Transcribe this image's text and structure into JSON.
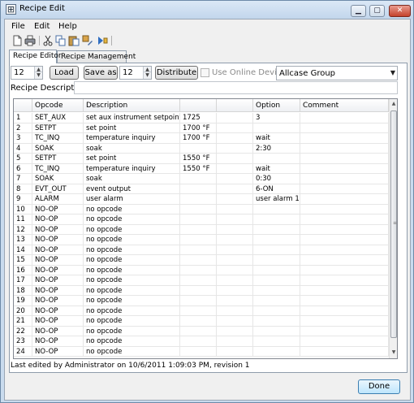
{
  "window": {
    "title": "Recipe Edit",
    "minimize": "▁",
    "maximize": "▢",
    "close": "✕"
  },
  "menu": [
    "File",
    "Edit",
    "Help"
  ],
  "toolbar_icons": [
    "new-file-icon",
    "print-icon",
    "cut-icon",
    "copy-icon",
    "paste-icon",
    "edit-icon",
    "run-icon"
  ],
  "tabs": [
    "Recipe Editor",
    "Recipe Management"
  ],
  "controls": {
    "recipe_number": "12",
    "load_label": "Load",
    "save_as_label": "Save as",
    "save_number": "12",
    "distribute_label": "Distribute",
    "use_online_label": "Use Online Device",
    "group_value": "Allcase Group",
    "description_label": "Recipe Description:",
    "description_value": ""
  },
  "grid": {
    "columns": [
      "",
      "Opcode",
      "Description",
      "",
      "",
      "Option",
      "Comment"
    ],
    "rows": [
      [
        "1",
        "SET_AUX",
        "set aux instrument setpoint",
        "1725",
        "",
        "3",
        ""
      ],
      [
        "2",
        "SETPT",
        "set point",
        "1700 °F",
        "",
        "",
        ""
      ],
      [
        "3",
        "TC_INQ",
        "temperature inquiry",
        "1700 °F",
        "",
        "wait",
        ""
      ],
      [
        "4",
        "SOAK",
        "soak",
        "",
        "",
        "2:30",
        ""
      ],
      [
        "5",
        "SETPT",
        "set point",
        "1550 °F",
        "",
        "",
        ""
      ],
      [
        "6",
        "TC_INQ",
        "temperature inquiry",
        "1550 °F",
        "",
        "wait",
        ""
      ],
      [
        "7",
        "SOAK",
        "soak",
        "",
        "",
        "0:30",
        ""
      ],
      [
        "8",
        "EVT_OUT",
        "event output",
        "",
        "",
        "6-ON",
        ""
      ],
      [
        "9",
        "ALARM",
        "user alarm",
        "",
        "",
        "user alarm 1",
        ""
      ],
      [
        "10",
        "NO-OP",
        "no opcode",
        "",
        "",
        "",
        ""
      ],
      [
        "11",
        "NO-OP",
        "no opcode",
        "",
        "",
        "",
        ""
      ],
      [
        "12",
        "NO-OP",
        "no opcode",
        "",
        "",
        "",
        ""
      ],
      [
        "13",
        "NO-OP",
        "no opcode",
        "",
        "",
        "",
        ""
      ],
      [
        "14",
        "NO-OP",
        "no opcode",
        "",
        "",
        "",
        ""
      ],
      [
        "15",
        "NO-OP",
        "no opcode",
        "",
        "",
        "",
        ""
      ],
      [
        "16",
        "NO-OP",
        "no opcode",
        "",
        "",
        "",
        ""
      ],
      [
        "17",
        "NO-OP",
        "no opcode",
        "",
        "",
        "",
        ""
      ],
      [
        "18",
        "NO-OP",
        "no opcode",
        "",
        "",
        "",
        ""
      ],
      [
        "19",
        "NO-OP",
        "no opcode",
        "",
        "",
        "",
        ""
      ],
      [
        "20",
        "NO-OP",
        "no opcode",
        "",
        "",
        "",
        ""
      ],
      [
        "21",
        "NO-OP",
        "no opcode",
        "",
        "",
        "",
        ""
      ],
      [
        "22",
        "NO-OP",
        "no opcode",
        "",
        "",
        "",
        ""
      ],
      [
        "23",
        "NO-OP",
        "no opcode",
        "",
        "",
        "",
        ""
      ],
      [
        "24",
        "NO-OP",
        "no opcode",
        "",
        "",
        "",
        ""
      ]
    ]
  },
  "status": "Last edited by Administrator on 10/6/2011 1:09:03 PM, revision 1",
  "done_label": "Done"
}
